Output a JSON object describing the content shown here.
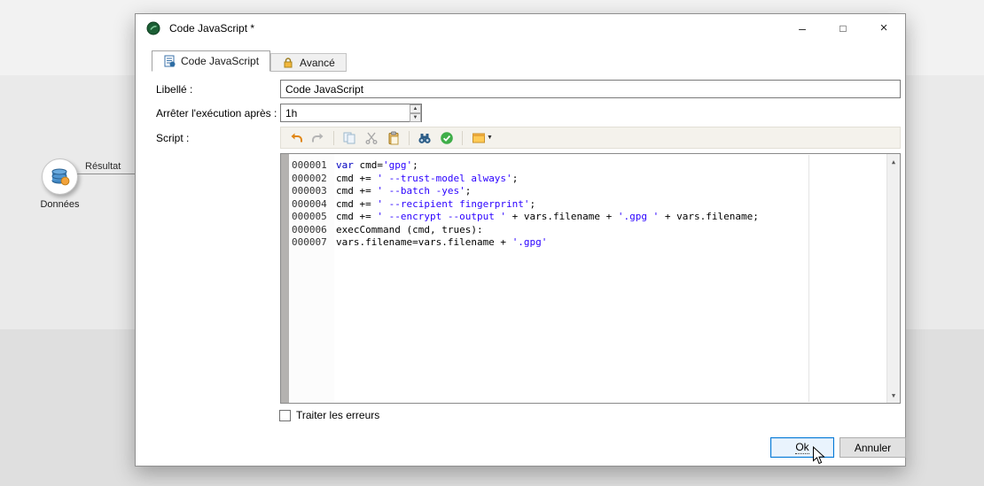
{
  "canvas": {
    "node_label": "Données",
    "connector_label": "Résultat"
  },
  "dialog": {
    "title": "Code JavaScript *",
    "window_controls": {
      "minimize": "–",
      "maximize": "□",
      "close": "×"
    },
    "tabs": [
      {
        "label": "Code JavaScript",
        "icon": "script-icon",
        "active": true
      },
      {
        "label": "Avancé",
        "icon": "lock-icon",
        "active": false
      }
    ],
    "form": {
      "label_caption": "Libellé :",
      "label_value": "Code JavaScript",
      "timeout_caption": "Arrêter l'exécution après :",
      "timeout_value": "1h",
      "script_caption": "Script :"
    },
    "toolbar": {
      "icons": [
        "undo-icon",
        "redo-icon",
        "copy-icon",
        "cut-icon",
        "paste-icon",
        "find-icon",
        "validate-icon",
        "insert-field-icon",
        "chevron-down-icon"
      ]
    },
    "editor": {
      "lines": [
        {
          "num": "000001",
          "segments": [
            [
              "k",
              "var"
            ],
            [
              "p",
              " cmd="
            ],
            [
              "s",
              "'gpg'"
            ],
            [
              "p",
              ";"
            ]
          ]
        },
        {
          "num": "000002",
          "segments": [
            [
              "p",
              "cmd += "
            ],
            [
              "s",
              "' --trust-model always'"
            ],
            [
              "p",
              ";"
            ]
          ]
        },
        {
          "num": "000003",
          "segments": [
            [
              "p",
              "cmd += "
            ],
            [
              "s",
              "' --batch -yes'"
            ],
            [
              "p",
              ";"
            ]
          ]
        },
        {
          "num": "000004",
          "segments": [
            [
              "p",
              "cmd += "
            ],
            [
              "s",
              "' --recipient fingerprint'"
            ],
            [
              "p",
              ";"
            ]
          ]
        },
        {
          "num": "000005",
          "segments": [
            [
              "p",
              "cmd += "
            ],
            [
              "s",
              "' --encrypt --output '"
            ],
            [
              "p",
              " + vars.filename + "
            ],
            [
              "s",
              "'.gpg '"
            ],
            [
              "p",
              " + vars.filename;"
            ]
          ]
        },
        {
          "num": "000006",
          "segments": [
            [
              "p",
              "execCommand (cmd, trues):"
            ]
          ]
        },
        {
          "num": "000007",
          "segments": [
            [
              "p",
              "vars.filename=vars.filename + "
            ],
            [
              "s",
              "'.gpg'"
            ]
          ]
        }
      ]
    },
    "error_checkbox_label": "Traiter les erreurs",
    "buttons": {
      "ok": "Ok",
      "cancel": "Annuler"
    },
    "colors": {
      "accent": "#0078d7",
      "keyword": "#0000c0",
      "string": "#2a00ff",
      "toolbar_orange": "#e08614",
      "check_green": "#3fae49"
    }
  }
}
